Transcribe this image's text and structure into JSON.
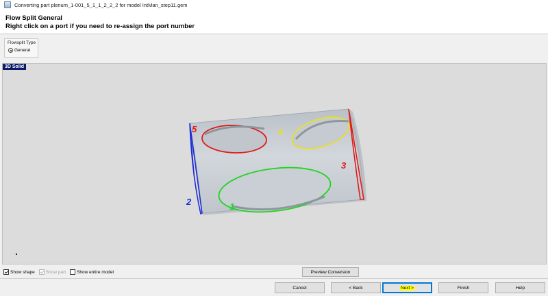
{
  "window": {
    "title": "Converting part plenum_1-001_5_1_1_2_2_2 for model IntMan_step11.gem"
  },
  "header": {
    "title": "Flow Split General",
    "subtitle": "Right click on a port if you need to re-assign the port number"
  },
  "flowsplit_type": {
    "label": "Flowsplit Type",
    "selected_option": "General"
  },
  "viewport": {
    "tag": "3D Solid",
    "ports": [
      {
        "number": "1",
        "color": "#1fd41f"
      },
      {
        "number": "2",
        "color": "#1f2fd6"
      },
      {
        "number": "3",
        "color": "#e01a1a"
      },
      {
        "number": "4",
        "color": "#e8e020"
      },
      {
        "number": "5",
        "color": "#e01a1a"
      }
    ],
    "part_color": "#c6ccd3"
  },
  "options": {
    "show_shape": {
      "label": "Show shape",
      "checked": true
    },
    "show_part": {
      "label": "Show part",
      "checked": true,
      "disabled": true
    },
    "show_entire_model": {
      "label": "Show entire model",
      "checked": false
    }
  },
  "buttons": {
    "preview": "Preview Conversion",
    "cancel": "Cancel",
    "back": "< Back",
    "next": "Next >",
    "finish": "Finish",
    "help": "Help"
  }
}
